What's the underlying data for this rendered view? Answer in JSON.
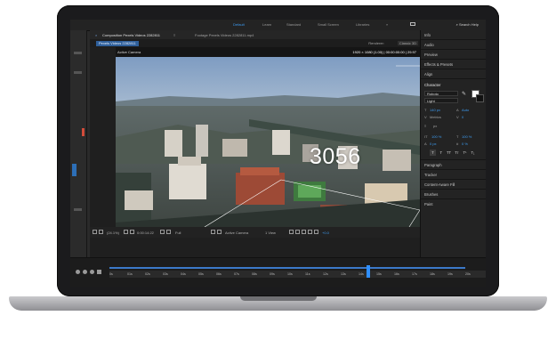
{
  "menubar": {
    "workspaces": [
      "Default",
      "Learn",
      "Standard",
      "Small Screen",
      "Libraries"
    ],
    "more": "»",
    "search_help": "Search Help"
  },
  "comp_tabs": {
    "composition": "Composition  Pexels Videos 2282811",
    "footage": "Footage  Pexels Videos 2282811.mp4"
  },
  "comp_breadcrumb": "Pexels Videos 2282811",
  "renderer": {
    "label": "Renderer:",
    "value": "Classic 3D"
  },
  "viewer": {
    "label": "Active Camera",
    "info": "1920 × 1080 (1.00) | 00:00:00:00 | 29.97",
    "number_overlay": "3056"
  },
  "viewer_controls": {
    "zoom": "(24.1%)",
    "timecode": "0:00:14:22",
    "resolution": "Full",
    "camera": "Active Camera",
    "views": "1 View",
    "exposure": "+0.0"
  },
  "timeline": {
    "ticks": [
      "0s",
      "01s",
      "02s",
      "03s",
      "04s",
      "05s",
      "06s",
      "07s",
      "08s",
      "09s",
      "10s",
      "11s",
      "12s",
      "13s",
      "14s",
      "15s",
      "16s",
      "17s",
      "18s",
      "19s",
      "20s"
    ]
  },
  "right_panel": {
    "sections_top": [
      "Info",
      "Audio",
      "Preview",
      "Effects & Presets",
      "Align",
      "Character"
    ],
    "font_family": "Roboto",
    "font_style": "Light",
    "font_size": "140 px",
    "leading": "Auto",
    "kerning": "Metrics",
    "tracking": "0",
    "stroke_unit": "px",
    "vert_scale": "100 %",
    "horiz_scale": "100 %",
    "baseline": "0 px",
    "tsume": "0 %",
    "para_buttons": [
      "T",
      "T",
      "TT",
      "Tт",
      "T¹",
      "T₁"
    ],
    "sections_bottom": [
      "Paragraph",
      "Tracker",
      "Content-Aware Fill",
      "Brushes",
      "Paint"
    ],
    "accent_color": "#3d9bf0"
  }
}
